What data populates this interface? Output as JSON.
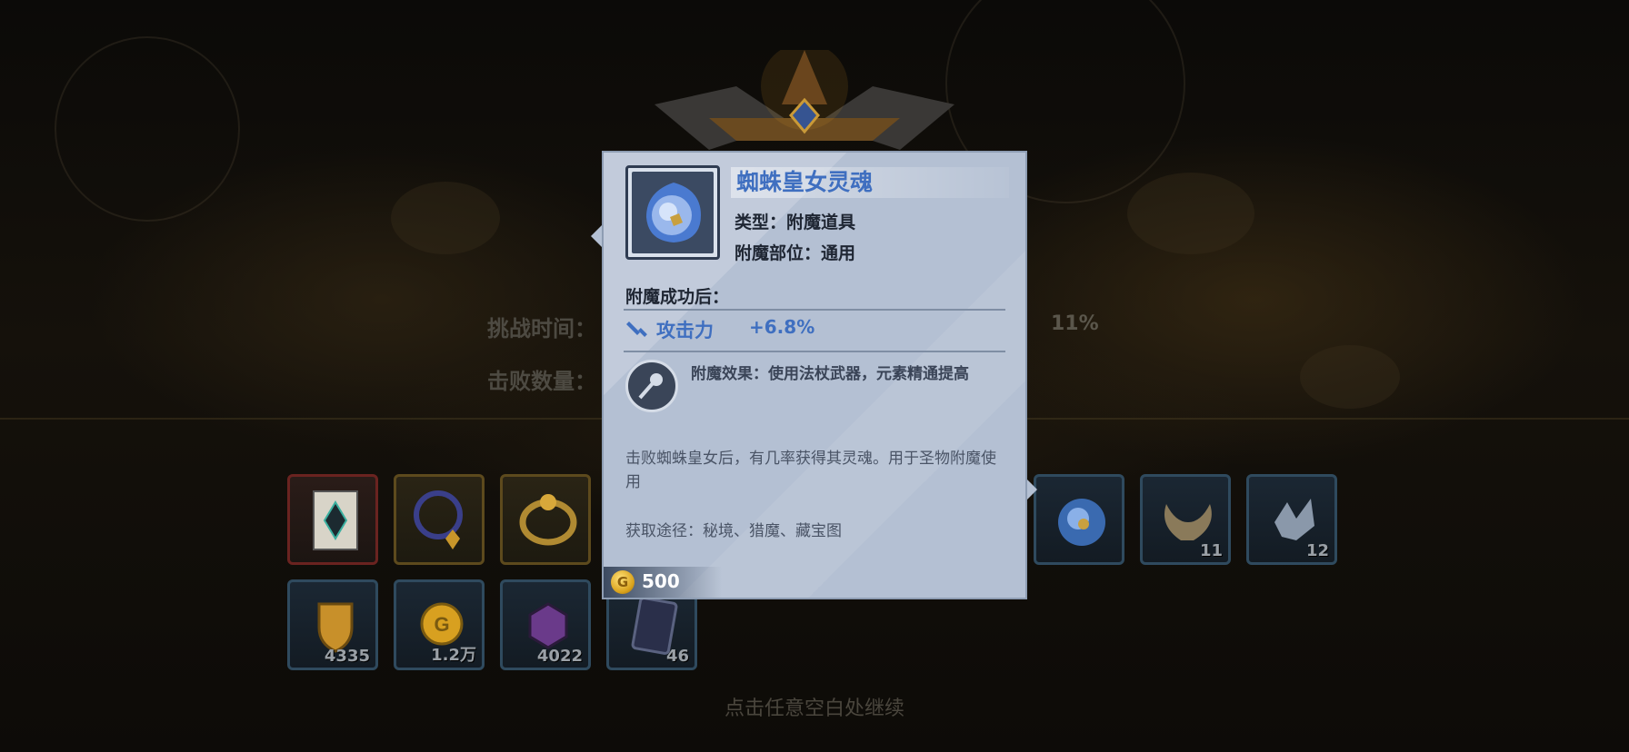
{
  "tooltip": {
    "item_name": "蜘蛛皇女灵魂",
    "type_line": "类型：附魔道具",
    "slot_line": "附魔部位：通用",
    "section_title": "附魔成功后：",
    "stat": {
      "label": "攻击力",
      "value": "+6.8%"
    },
    "effect": "附魔效果：使用法杖武器，元素精通提高",
    "description": "击败蜘蛛皇女后，有几率获得其灵魂。用于圣物附魔使用",
    "source": "获取途径：秘境、猎魔、藏宝图",
    "price": "500",
    "coin_symbol": "G",
    "name_color": "#3f6fc0",
    "background_color": "#b4c0d3"
  },
  "background_stats": {
    "challenge_time_label": "挑战时间：",
    "defeat_count_label": "击败数量：",
    "percent_value": "11%"
  },
  "rewards": [
    {
      "icon": "scroll-icon",
      "count": ""
    },
    {
      "icon": "necklace-icon",
      "count": ""
    },
    {
      "icon": "gold-ring-icon",
      "count": ""
    },
    {
      "icon": "spider-soul-icon",
      "count": ""
    },
    {
      "icon": "horn-icon",
      "count": "11"
    },
    {
      "icon": "crystal-shard-icon",
      "count": "12"
    },
    {
      "icon": "shield-badge-icon",
      "count": "4335"
    },
    {
      "icon": "gold-coin-icon",
      "count": "1.2万"
    },
    {
      "icon": "purple-gem-icon",
      "count": "4022"
    },
    {
      "icon": "dark-card-icon",
      "count": "46"
    }
  ],
  "footer": {
    "continue_hint": "点击任意空白处继续"
  }
}
